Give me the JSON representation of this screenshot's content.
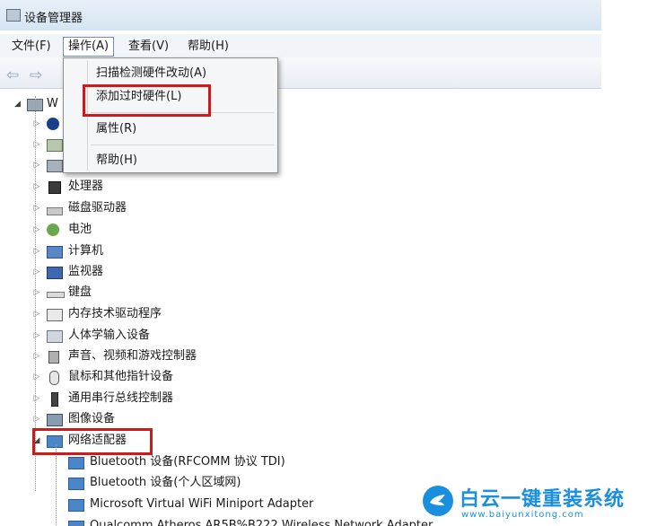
{
  "window": {
    "title": "设备管理器"
  },
  "menu": {
    "file": "文件(F)",
    "action": "操作(A)",
    "view": "查看(V)",
    "help": "帮助(H)"
  },
  "dropdown": {
    "items": [
      "扫描检测硬件改动(A)",
      "添加过时硬件(L)",
      "属性(R)",
      "帮助(H)"
    ],
    "highlighted": "添加过时硬件(L)"
  },
  "tree": {
    "root_label": "W",
    "categories": [
      {
        "label": "",
        "icon": "bluetooth-icon"
      },
      {
        "label": "",
        "icon": "network-device-icon"
      },
      {
        "label": "",
        "icon": "device-icon"
      },
      {
        "label": "处理器",
        "icon": "processor-icon"
      },
      {
        "label": "磁盘驱动器",
        "icon": "disk-drive-icon"
      },
      {
        "label": "电池",
        "icon": "battery-icon"
      },
      {
        "label": "计算机",
        "icon": "computer-icon"
      },
      {
        "label": "监视器",
        "icon": "monitor-icon"
      },
      {
        "label": "键盘",
        "icon": "keyboard-icon"
      },
      {
        "label": "内存技术驱动程序",
        "icon": "memory-icon"
      },
      {
        "label": "人体学输入设备",
        "icon": "hid-icon"
      },
      {
        "label": "声音、视频和游戏控制器",
        "icon": "speaker-icon"
      },
      {
        "label": "鼠标和其他指针设备",
        "icon": "mouse-icon"
      },
      {
        "label": "通用串行总线控制器",
        "icon": "usb-icon"
      },
      {
        "label": "图像设备",
        "icon": "camera-icon"
      },
      {
        "label": "网络适配器",
        "icon": "network-adapter-icon"
      }
    ],
    "network_children": [
      "Bluetooth 设备(RFCOMM 协议 TDI)",
      "Bluetooth 设备(个人区域网)",
      "Microsoft Virtual WiFi Miniport Adapter",
      "Qualcomm Atheros AR5B%B222 Wireless Network Adapter"
    ]
  },
  "watermark": {
    "brand": "白云一键重装系统",
    "url": "www.baiyunxitong.com"
  },
  "colors": {
    "highlight_box": "#d01a1a",
    "brand": "#1a8fe0"
  }
}
